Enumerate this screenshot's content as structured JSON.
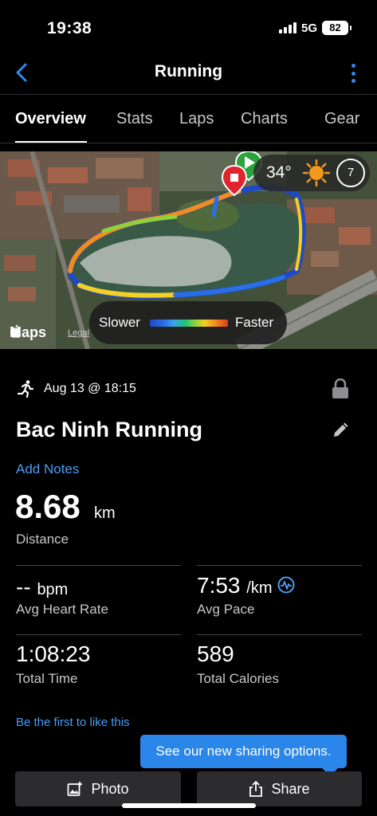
{
  "status_bar": {
    "time": "19:38",
    "network": "5G",
    "battery": "82"
  },
  "header": {
    "title": "Running",
    "back_icon": "chevron-left-icon",
    "more_icon": "vertical-dots-icon"
  },
  "tabs": [
    "Overview",
    "Stats",
    "Laps",
    "Charts",
    "Gear"
  ],
  "active_tab": "Overview",
  "map": {
    "weather_temp": "34°",
    "wind_speed": "7",
    "legend_slower": "Slower",
    "legend_faster": "Faster",
    "maps_brand": "Maps",
    "legal": "Legal"
  },
  "activity": {
    "date": "Aug 13 @ 18:15",
    "name": "Bac Ninh Running",
    "add_notes": "Add Notes",
    "distance_value": "8.68",
    "distance_unit": "km",
    "distance_label": "Distance"
  },
  "stats": {
    "heart_rate_value": "--",
    "heart_rate_unit": "bpm",
    "heart_rate_label": "Avg Heart Rate",
    "pace_value": "7:53",
    "pace_unit": "/km",
    "pace_label": "Avg Pace",
    "time_value": "1:08:23",
    "time_label": "Total Time",
    "calories_value": "589",
    "calories_label": "Total Calories"
  },
  "social": {
    "like_text": "Be the first to like this"
  },
  "tooltip": {
    "text": "See our new sharing options."
  },
  "buttons": {
    "photo": "Photo",
    "share": "Share"
  },
  "colors": {
    "accent": "#4a9cf5",
    "tooltip": "#2a86e8",
    "background": "#000000"
  }
}
